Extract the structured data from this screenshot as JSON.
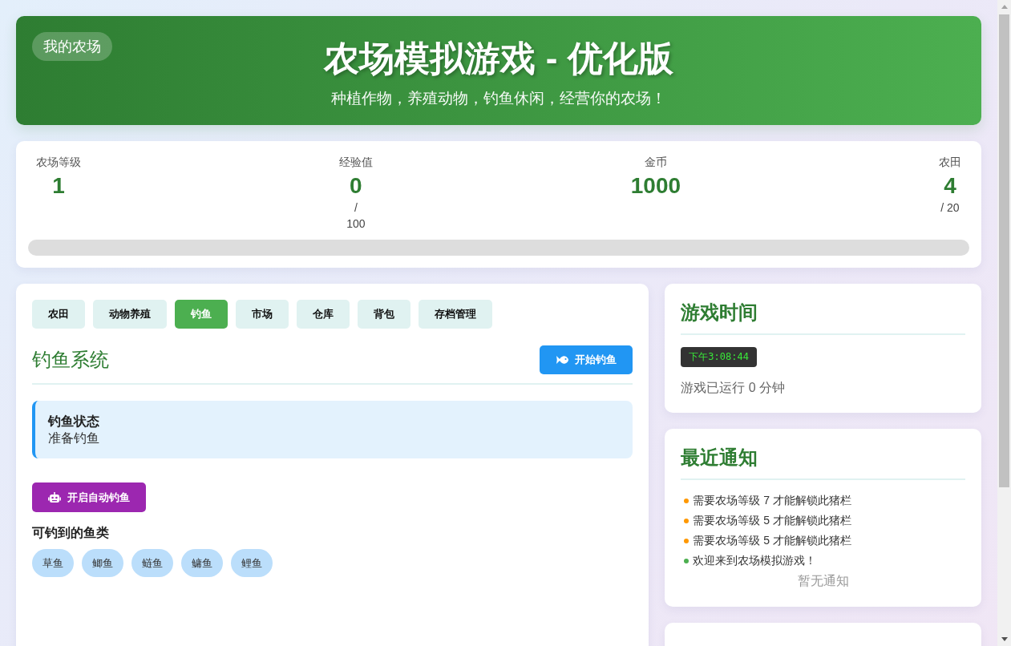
{
  "header": {
    "badge": "我的农场",
    "title": "农场模拟游戏 - 优化版",
    "subtitle": "种植作物，养殖动物，钓鱼休闲，经营你的农场！"
  },
  "stats": {
    "items": [
      {
        "label": "农场等级",
        "value": "1"
      },
      {
        "label": "经验值",
        "value": "0",
        "sub": "/ 100"
      },
      {
        "label": "金币",
        "value": "1000"
      },
      {
        "label": "农田",
        "value": "4",
        "sub": "/ 20"
      }
    ],
    "progress": {
      "level": 0
    }
  },
  "tabs": [
    {
      "label": "农田",
      "selected": false
    },
    {
      "label": "动物养殖",
      "selected": false
    },
    {
      "label": "钓鱼",
      "selected": true
    },
    {
      "label": "市场",
      "selected": false
    },
    {
      "label": "仓库",
      "selected": false
    },
    {
      "label": "背包",
      "selected": false
    },
    {
      "label": "存档管理",
      "selected": false
    }
  ],
  "fishing": {
    "title": "钓鱼系统",
    "start_button": "开始钓鱼",
    "status": {
      "label": "钓鱼状态",
      "value": "准备钓鱼"
    },
    "auto_button": "开启自动钓鱼",
    "fish_title": "可钓到的鱼类",
    "fish": [
      "草鱼",
      "鲫鱼",
      "鲢鱼",
      "鳙鱼",
      "鲤鱼"
    ]
  },
  "game_time": {
    "title": "游戏时间",
    "clock": "下午3:08:44",
    "runtime": "游戏已运行 0 分钟"
  },
  "notifications": {
    "title": "最近通知",
    "items": [
      {
        "text": "需要农场等级 7 才能解锁此猪栏",
        "color": "#ff9800"
      },
      {
        "text": "需要农场等级 5 才能解锁此猪栏",
        "color": "#ff9800"
      },
      {
        "text": "需要农场等级 5 才能解锁此猪栏",
        "color": "#ff9800"
      },
      {
        "text": "欢迎来到农场模拟游戏！",
        "color": "#4caf50"
      }
    ],
    "empty": "暂无通知"
  }
}
